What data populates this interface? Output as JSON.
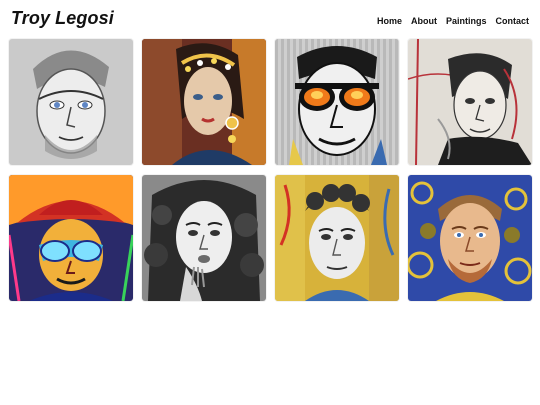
{
  "site": {
    "title": "Troy Legosi"
  },
  "nav": {
    "items": [
      {
        "label": "Home"
      },
      {
        "label": "About"
      },
      {
        "label": "Paintings"
      },
      {
        "label": "Contact"
      }
    ]
  },
  "gallery": {
    "items": [
      {
        "name": "painting-man-graphite-blue-eyes",
        "bg": "#cfcfcf",
        "accent": "#6f8fb8",
        "skin": "#e6e6e6"
      },
      {
        "name": "painting-woman-jeweled-headdress",
        "bg": "#7a3b2a",
        "accent": "#e8b33c",
        "skin": "#e2c6a8"
      },
      {
        "name": "painting-man-orange-sunglasses",
        "bg": "#c9c9c9",
        "accent": "#f07a1a",
        "skin": "#f2f2f2"
      },
      {
        "name": "painting-man-sketch-red-lines",
        "bg": "#d9d4cc",
        "accent": "#b8323a",
        "skin": "#ece8e2"
      },
      {
        "name": "painting-man-red-hat-aviators",
        "bg": "#d43a2a",
        "accent": "#3fb6e0",
        "skin": "#f0b23a"
      },
      {
        "name": "painting-woman-curly-hair-monochrome",
        "bg": "#7a7a7a",
        "accent": "#2b2b2b",
        "skin": "#e6e6e6"
      },
      {
        "name": "painting-man-curly-hair-colorful",
        "bg": "#d7b23a",
        "accent": "#3a6bb0",
        "skin": "#e6e6e6"
      },
      {
        "name": "painting-man-beard-gold-swirls",
        "bg": "#2f4aa8",
        "accent": "#e4c23a",
        "skin": "#e8b98d"
      }
    ]
  }
}
